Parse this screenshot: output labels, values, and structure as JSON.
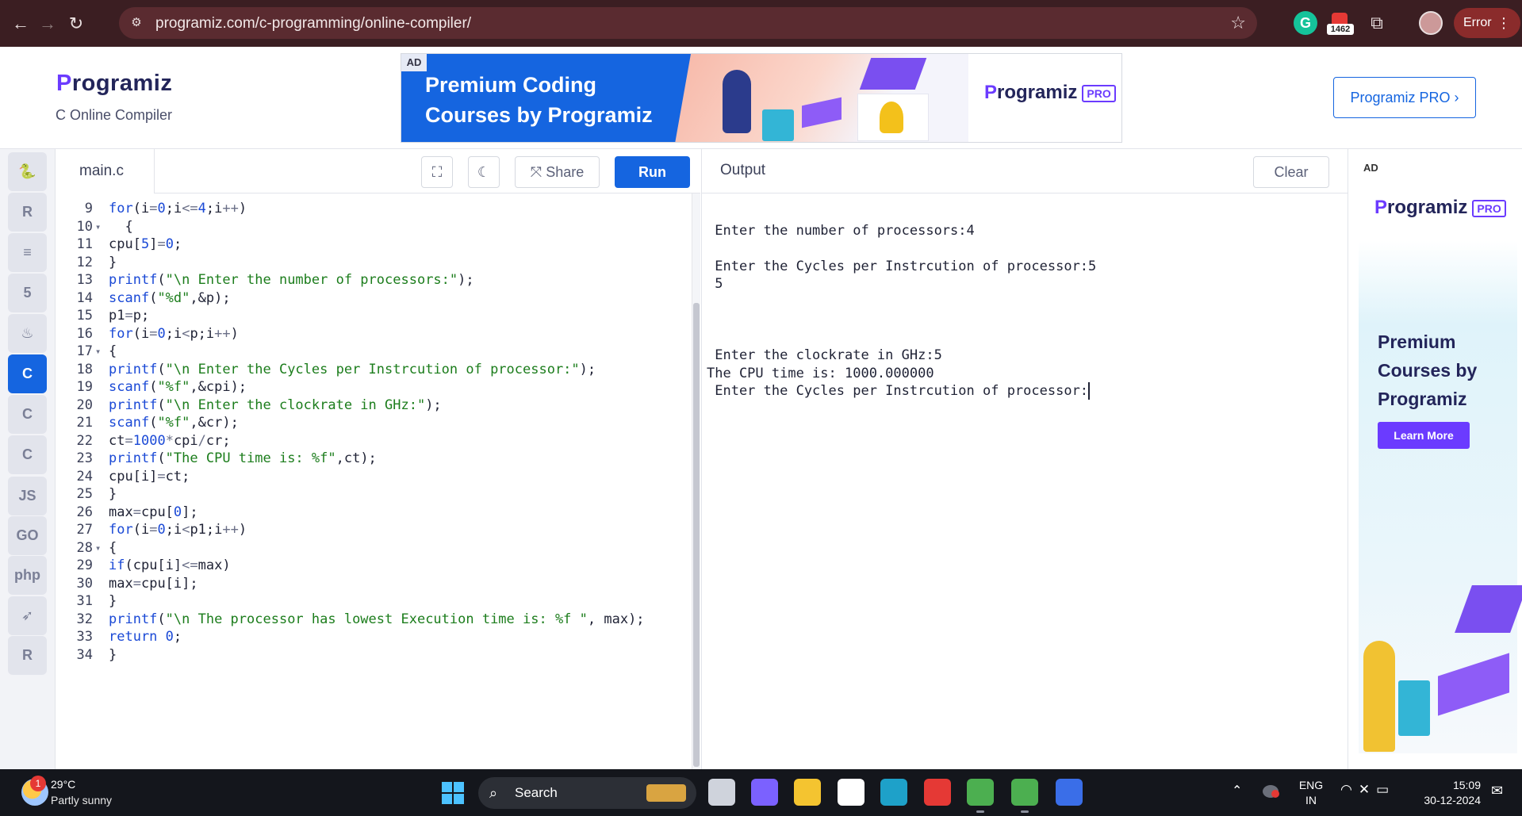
{
  "browser": {
    "url": "programiz.com/c-programming/online-compiler/",
    "extension_badge": "1462",
    "profile_status": "Error"
  },
  "header": {
    "logo_text": "rogramiz",
    "logo_letter": "P",
    "subtitle": "C Online Compiler",
    "ad_tag": "AD",
    "ad_headline": "Premium Coding Courses by Programiz",
    "ad_pro_logo": "rogramiz",
    "ad_pro_tag": "PRO",
    "pro_button": "Programiz PRO ›"
  },
  "rail": {
    "items": [
      {
        "icon": "python-icon",
        "glyph": "🐍"
      },
      {
        "icon": "r-icon",
        "glyph": "R"
      },
      {
        "icon": "sql-icon",
        "glyph": "≡"
      },
      {
        "icon": "html-icon",
        "glyph": "5"
      },
      {
        "icon": "java-icon",
        "glyph": "♨"
      },
      {
        "icon": "c-icon",
        "glyph": "C"
      },
      {
        "icon": "cpp-icon",
        "glyph": "C"
      },
      {
        "icon": "csharp-icon",
        "glyph": "C"
      },
      {
        "icon": "js-icon",
        "glyph": "JS"
      },
      {
        "icon": "go-icon",
        "glyph": "GO"
      },
      {
        "icon": "php-icon",
        "glyph": "php"
      },
      {
        "icon": "swift-icon",
        "glyph": "➶"
      },
      {
        "icon": "rust-icon",
        "glyph": "R"
      }
    ]
  },
  "editor": {
    "file_name": "main.c",
    "fullscreen_glyph": "⛶",
    "theme_glyph": "☾",
    "share_label": "Share",
    "share_glyph": "⤧",
    "run_label": "Run",
    "lines": [
      {
        "n": "9",
        "fold": false,
        "code": [
          [
            "kw",
            "for"
          ],
          [
            "",
            "(i"
          ],
          [
            "op",
            "="
          ],
          [
            "num",
            "0"
          ],
          [
            "",
            ";i"
          ],
          [
            "op",
            "<="
          ],
          [
            "num",
            "4"
          ],
          [
            "",
            ";i"
          ],
          [
            "op",
            "++"
          ],
          [
            "",
            ")"
          ]
        ]
      },
      {
        "n": "10",
        "fold": true,
        "code": [
          [
            "",
            "  {"
          ]
        ]
      },
      {
        "n": "11",
        "fold": false,
        "code": [
          [
            "",
            "cpu["
          ],
          [
            "num",
            "5"
          ],
          [
            "",
            "]"
          ],
          [
            "op",
            "="
          ],
          [
            "num",
            "0"
          ],
          [
            "",
            ";"
          ]
        ]
      },
      {
        "n": "12",
        "fold": false,
        "code": [
          [
            "",
            "}"
          ]
        ]
      },
      {
        "n": "13",
        "fold": false,
        "code": [
          [
            "kw",
            "printf"
          ],
          [
            "",
            "("
          ],
          [
            "str",
            "\"\\n Enter the number of processors:\""
          ],
          [
            "",
            ");"
          ]
        ]
      },
      {
        "n": "14",
        "fold": false,
        "code": [
          [
            "kw",
            "scanf"
          ],
          [
            "",
            "("
          ],
          [
            "str",
            "\"%d\""
          ],
          [
            "",
            ",&p);"
          ]
        ]
      },
      {
        "n": "15",
        "fold": false,
        "code": [
          [
            "",
            "p1"
          ],
          [
            "op",
            "="
          ],
          [
            "",
            "p;"
          ]
        ]
      },
      {
        "n": "16",
        "fold": false,
        "code": [
          [
            "kw",
            "for"
          ],
          [
            "",
            "(i"
          ],
          [
            "op",
            "="
          ],
          [
            "num",
            "0"
          ],
          [
            "",
            ";i"
          ],
          [
            "op",
            "<"
          ],
          [
            "",
            "p;i"
          ],
          [
            "op",
            "++"
          ],
          [
            "",
            ")"
          ]
        ]
      },
      {
        "n": "17",
        "fold": true,
        "code": [
          [
            "",
            "{"
          ]
        ]
      },
      {
        "n": "18",
        "fold": false,
        "code": [
          [
            "kw",
            "printf"
          ],
          [
            "",
            "("
          ],
          [
            "str",
            "\"\\n Enter the Cycles per Instrcution of processor:\""
          ],
          [
            "",
            ");"
          ]
        ]
      },
      {
        "n": "19",
        "fold": false,
        "code": [
          [
            "kw",
            "scanf"
          ],
          [
            "",
            "("
          ],
          [
            "str",
            "\"%f\""
          ],
          [
            "",
            ",&cpi);"
          ]
        ]
      },
      {
        "n": "20",
        "fold": false,
        "code": [
          [
            "kw",
            "printf"
          ],
          [
            "",
            "("
          ],
          [
            "str",
            "\"\\n Enter the clockrate in GHz:\""
          ],
          [
            "",
            ");"
          ]
        ]
      },
      {
        "n": "21",
        "fold": false,
        "code": [
          [
            "kw",
            "scanf"
          ],
          [
            "",
            "("
          ],
          [
            "str",
            "\"%f\""
          ],
          [
            "",
            ",&cr);"
          ]
        ]
      },
      {
        "n": "22",
        "fold": false,
        "code": [
          [
            "",
            "ct"
          ],
          [
            "op",
            "="
          ],
          [
            "num",
            "1000"
          ],
          [
            "op",
            "*"
          ],
          [
            "",
            "cpi"
          ],
          [
            "op",
            "/"
          ],
          [
            "",
            "cr;"
          ]
        ]
      },
      {
        "n": "23",
        "fold": false,
        "code": [
          [
            "kw",
            "printf"
          ],
          [
            "",
            "("
          ],
          [
            "str",
            "\"The CPU time is: %f\""
          ],
          [
            "",
            ",ct);"
          ]
        ]
      },
      {
        "n": "24",
        "fold": false,
        "code": [
          [
            "",
            "cpu[i]"
          ],
          [
            "op",
            "="
          ],
          [
            "",
            "ct;"
          ]
        ]
      },
      {
        "n": "25",
        "fold": false,
        "code": [
          [
            "",
            "}"
          ]
        ]
      },
      {
        "n": "26",
        "fold": false,
        "code": [
          [
            "",
            "max"
          ],
          [
            "op",
            "="
          ],
          [
            "",
            "cpu["
          ],
          [
            "num",
            "0"
          ],
          [
            "",
            "];"
          ]
        ]
      },
      {
        "n": "27",
        "fold": false,
        "code": [
          [
            "kw",
            "for"
          ],
          [
            "",
            "(i"
          ],
          [
            "op",
            "="
          ],
          [
            "num",
            "0"
          ],
          [
            "",
            ";i"
          ],
          [
            "op",
            "<"
          ],
          [
            "",
            "p1;i"
          ],
          [
            "op",
            "++"
          ],
          [
            "",
            ")"
          ]
        ]
      },
      {
        "n": "28",
        "fold": true,
        "code": [
          [
            "",
            "{"
          ]
        ]
      },
      {
        "n": "29",
        "fold": false,
        "code": [
          [
            "kw",
            "if"
          ],
          [
            "",
            "(cpu[i]"
          ],
          [
            "op",
            "<="
          ],
          [
            "",
            "max)"
          ]
        ]
      },
      {
        "n": "30",
        "fold": false,
        "code": [
          [
            "",
            "max"
          ],
          [
            "op",
            "="
          ],
          [
            "",
            "cpu[i];"
          ]
        ]
      },
      {
        "n": "31",
        "fold": false,
        "code": [
          [
            "",
            "}"
          ]
        ]
      },
      {
        "n": "32",
        "fold": false,
        "code": [
          [
            "kw",
            "printf"
          ],
          [
            "",
            "("
          ],
          [
            "str",
            "\"\\n The processor has lowest Execution time is: %f \""
          ],
          [
            "",
            ", max);"
          ]
        ]
      },
      {
        "n": "33",
        "fold": false,
        "code": [
          [
            "kw",
            "return"
          ],
          [
            "",
            " "
          ],
          [
            "num",
            "0"
          ],
          [
            "",
            ";"
          ]
        ]
      },
      {
        "n": "34",
        "fold": false,
        "code": [
          [
            "",
            "}"
          ]
        ]
      }
    ]
  },
  "output": {
    "title": "Output",
    "clear_label": "Clear",
    "lines": [
      "",
      " Enter the number of processors:4",
      "",
      " Enter the Cycles per Instrcution of processor:5",
      " 5",
      "",
      "",
      "",
      " Enter the clockrate in GHz:5",
      "The CPU time is: 1000.000000",
      " Enter the Cycles per Instrcution of processor:"
    ]
  },
  "side_ad": {
    "ad_tag": "AD",
    "logo_text": "rogramiz",
    "logo_letter": "P",
    "pro_tag": "PRO",
    "headline": "Premium Courses by Programiz",
    "button": "Learn More"
  },
  "taskbar": {
    "weather_badge": "1",
    "temperature": "29°C",
    "condition": "Partly sunny",
    "search_label": "Search",
    "lang_line1": "ENG",
    "lang_line2": "IN",
    "time": "15:09",
    "date": "30-12-2024",
    "apps": [
      {
        "name": "task-view-icon",
        "color": "#cfd3dc"
      },
      {
        "name": "copilot-icon",
        "color": "#7b61ff"
      },
      {
        "name": "file-explorer-icon",
        "color": "#f4c430"
      },
      {
        "name": "microsoft-store-icon",
        "color": "#ffffff"
      },
      {
        "name": "edge-icon",
        "color": "#1ea1c9"
      },
      {
        "name": "wps-icon",
        "color": "#e53935"
      },
      {
        "name": "chrome-icon",
        "color": "#4caf50"
      },
      {
        "name": "chrome-profile-icon",
        "color": "#4caf50"
      },
      {
        "name": "dev-home-icon",
        "color": "#3a6ee8"
      }
    ]
  }
}
